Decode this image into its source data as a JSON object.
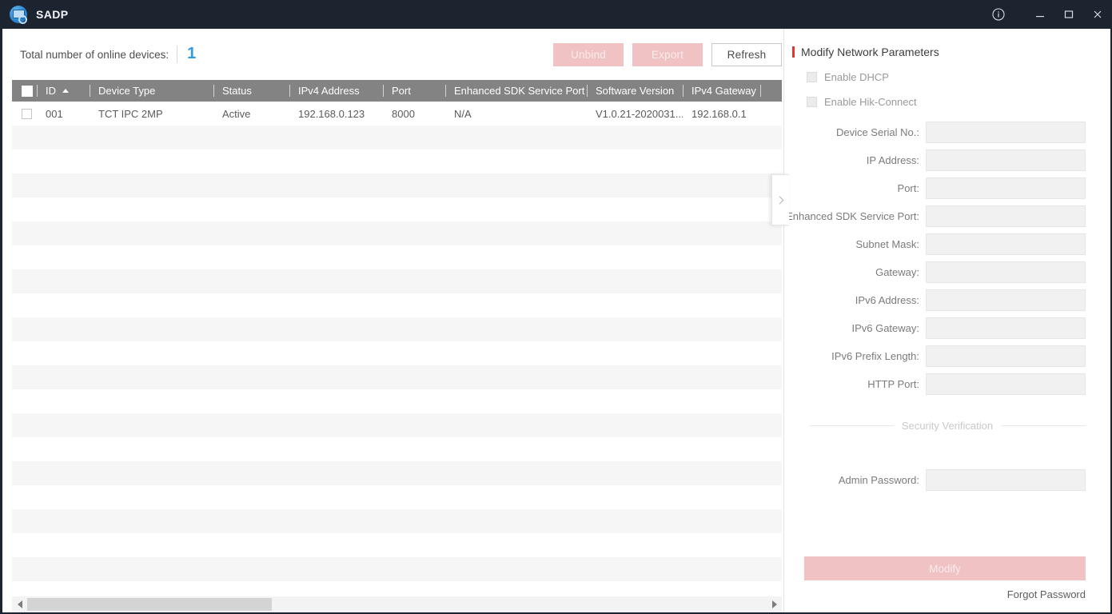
{
  "titlebar": {
    "app_name": "SADP",
    "logo_icon": "sadp-logo-icon",
    "info_icon": "info-circle-icon",
    "minimize_icon": "minimize-icon",
    "maximize_icon": "maximize-icon",
    "close_icon": "close-icon"
  },
  "toolbar": {
    "total_label": "Total number of online devices:",
    "total_count": "1",
    "unbind_label": "Unbind",
    "export_label": "Export",
    "refresh_label": "Refresh"
  },
  "table": {
    "sort_column": "ID",
    "sort_direction": "ascending",
    "columns": [
      {
        "key": "check",
        "label": ""
      },
      {
        "key": "id",
        "label": "ID"
      },
      {
        "key": "type",
        "label": "Device Type"
      },
      {
        "key": "status",
        "label": "Status"
      },
      {
        "key": "ipv4",
        "label": "IPv4 Address"
      },
      {
        "key": "port",
        "label": "Port"
      },
      {
        "key": "sdk",
        "label": "Enhanced SDK Service Port"
      },
      {
        "key": "software",
        "label": "Software Version"
      },
      {
        "key": "gateway",
        "label": "IPv4 Gateway"
      }
    ],
    "rows": [
      {
        "id": "001",
        "type": "TCT IPC 2MP",
        "status": "Active",
        "ipv4": "192.168.0.123",
        "port": "8000",
        "sdk": "N/A",
        "software": "V1.0.21-2020031...",
        "gateway": "192.168.0.1"
      }
    ],
    "empty_row_count": 19
  },
  "scrollbar": {
    "left_arrow_icon": "scroll-left-arrow-icon",
    "right_arrow_icon": "scroll-right-arrow-icon"
  },
  "collapse": {
    "icon": "chevron-right-icon"
  },
  "panel": {
    "title": "Modify Network Parameters",
    "checkboxes": [
      {
        "label": "Enable DHCP",
        "checked": false
      },
      {
        "label": "Enable Hik-Connect",
        "checked": false
      }
    ],
    "fields": [
      {
        "label": "Device Serial No.:",
        "value": "",
        "name": "device-serial-no"
      },
      {
        "label": "IP Address:",
        "value": "",
        "name": "ip-address"
      },
      {
        "label": "Port:",
        "value": "",
        "name": "port"
      },
      {
        "label": "Enhanced SDK Service Port:",
        "value": "",
        "name": "enhanced-sdk-service-port"
      },
      {
        "label": "Subnet Mask:",
        "value": "",
        "name": "subnet-mask"
      },
      {
        "label": "Gateway:",
        "value": "",
        "name": "gateway"
      },
      {
        "label": "IPv6 Address:",
        "value": "",
        "name": "ipv6-address"
      },
      {
        "label": "IPv6 Gateway:",
        "value": "",
        "name": "ipv6-gateway"
      },
      {
        "label": "IPv6 Prefix Length:",
        "value": "",
        "name": "ipv6-prefix-length"
      },
      {
        "label": "HTTP Port:",
        "value": "",
        "name": "http-port"
      }
    ],
    "security_divider": "Security Verification",
    "admin_password_label": "Admin Password:",
    "admin_password_value": "",
    "modify_label": "Modify",
    "forgot_password_label": "Forgot Password"
  },
  "colors": {
    "titlebar_bg": "#1c2430",
    "accent_red": "#e8322d",
    "count_blue": "#2f9be5",
    "disabled_pink": "#f0c2c4",
    "header_gray": "#838383",
    "stripe_gray": "#f6f6f6"
  }
}
